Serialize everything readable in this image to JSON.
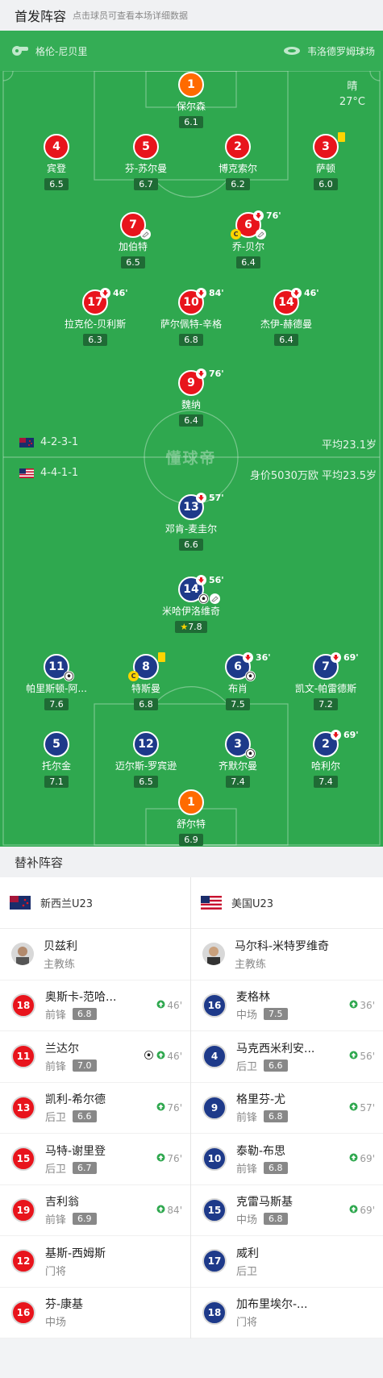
{
  "header": {
    "title": "首发阵容",
    "subtitle": "点击球员可查看本场详细数据"
  },
  "venue": {
    "referee": "格伦-尼贝里",
    "stadium": "韦洛德罗姆球场"
  },
  "weather": {
    "condition": "晴",
    "temp": "27°C"
  },
  "watermark": "懂球帝",
  "home": {
    "formation": "4-2-3-1",
    "avg_age": "平均23.1岁",
    "players": [
      {
        "num": "1",
        "name": "保尔森",
        "rating": "6.1",
        "color": "o"
      },
      {
        "num": "4",
        "name": "宾登",
        "rating": "6.5",
        "color": "r"
      },
      {
        "num": "5",
        "name": "芬-苏尔曼",
        "rating": "6.7",
        "color": "r"
      },
      {
        "num": "2",
        "name": "博克索尔",
        "rating": "6.2",
        "color": "r"
      },
      {
        "num": "3",
        "name": "萨顿",
        "rating": "6.0",
        "color": "r"
      },
      {
        "num": "7",
        "name": "加伯特",
        "rating": "6.5",
        "color": "r"
      },
      {
        "num": "6",
        "name": "乔-贝尔",
        "rating": "6.4",
        "color": "r",
        "sub": "76'"
      },
      {
        "num": "17",
        "name": "拉克伦-贝利斯",
        "rating": "6.3",
        "color": "r",
        "sub": "46'"
      },
      {
        "num": "10",
        "name": "萨尔佩特-辛格",
        "rating": "6.8",
        "color": "r",
        "sub": "84'"
      },
      {
        "num": "14",
        "name": "杰伊-赫德曼",
        "rating": "6.4",
        "color": "r",
        "sub": "46'"
      },
      {
        "num": "9",
        "name": "魏纳",
        "rating": "6.4",
        "color": "r",
        "sub": "76'"
      }
    ]
  },
  "away": {
    "formation": "4-4-1-1",
    "value_age": "身价5030万欧 平均23.5岁",
    "players": [
      {
        "num": "13",
        "name": "邓肯-麦圭尔",
        "rating": "6.6",
        "color": "b",
        "sub": "57'"
      },
      {
        "num": "14",
        "name": "米哈伊洛维奇",
        "rating": "7.8",
        "color": "b",
        "sub": "56'"
      },
      {
        "num": "11",
        "name": "帕里斯顿-阿...",
        "rating": "7.6",
        "color": "b"
      },
      {
        "num": "8",
        "name": "特斯曼",
        "rating": "6.8",
        "color": "b"
      },
      {
        "num": "6",
        "name": "布肖",
        "rating": "7.5",
        "color": "b",
        "sub": "36'"
      },
      {
        "num": "7",
        "name": "凯文-帕雷德斯",
        "rating": "7.2",
        "color": "b",
        "sub": "69'"
      },
      {
        "num": "5",
        "name": "托尔金",
        "rating": "7.1",
        "color": "b"
      },
      {
        "num": "12",
        "name": "迈尔斯-罗宾逊",
        "rating": "6.5",
        "color": "b"
      },
      {
        "num": "3",
        "name": "齐默尔曼",
        "rating": "7.4",
        "color": "b"
      },
      {
        "num": "2",
        "name": "哈利尔",
        "rating": "7.4",
        "color": "b",
        "sub": "69'"
      },
      {
        "num": "1",
        "name": "舒尔特",
        "rating": "6.9",
        "color": "o"
      }
    ]
  },
  "bench": {
    "title": "替补阵容",
    "home_team": "新西兰U23",
    "away_team": "美国U23",
    "home_coach": {
      "name": "贝兹利",
      "role": "主教练"
    },
    "away_coach": {
      "name": "马尔科-米特罗维奇",
      "role": "主教练"
    },
    "home": [
      {
        "num": "18",
        "name": "奥斯卡-范哈...",
        "pos": "前锋",
        "rating": "6.8",
        "min": "46'"
      },
      {
        "num": "11",
        "name": "兰达尔",
        "pos": "前锋",
        "rating": "7.0",
        "min": "46'",
        "goal": true
      },
      {
        "num": "13",
        "name": "凯利-希尔德",
        "pos": "后卫",
        "rating": "6.6",
        "min": "76'"
      },
      {
        "num": "15",
        "name": "马特-谢里登",
        "pos": "后卫",
        "rating": "6.7",
        "min": "76'"
      },
      {
        "num": "19",
        "name": "吉利翁",
        "pos": "前锋",
        "rating": "6.9",
        "min": "84'"
      },
      {
        "num": "12",
        "name": "基斯-西姆斯",
        "pos": "门将"
      },
      {
        "num": "16",
        "name": "芬-康基",
        "pos": "中场"
      }
    ],
    "away": [
      {
        "num": "16",
        "name": "麦格林",
        "pos": "中场",
        "rating": "7.5",
        "min": "36'"
      },
      {
        "num": "4",
        "name": "马克西米利安...",
        "pos": "后卫",
        "rating": "6.6",
        "min": "56'"
      },
      {
        "num": "9",
        "name": "格里芬-尤",
        "pos": "前锋",
        "rating": "6.8",
        "min": "57'"
      },
      {
        "num": "10",
        "name": "泰勒-布思",
        "pos": "前锋",
        "rating": "6.8",
        "min": "69'"
      },
      {
        "num": "15",
        "name": "克雷马斯基",
        "pos": "中场",
        "rating": "6.8",
        "min": "69'"
      },
      {
        "num": "17",
        "name": "威利",
        "pos": "后卫"
      },
      {
        "num": "18",
        "name": "加布里埃尔-...",
        "pos": "门将"
      }
    ]
  }
}
